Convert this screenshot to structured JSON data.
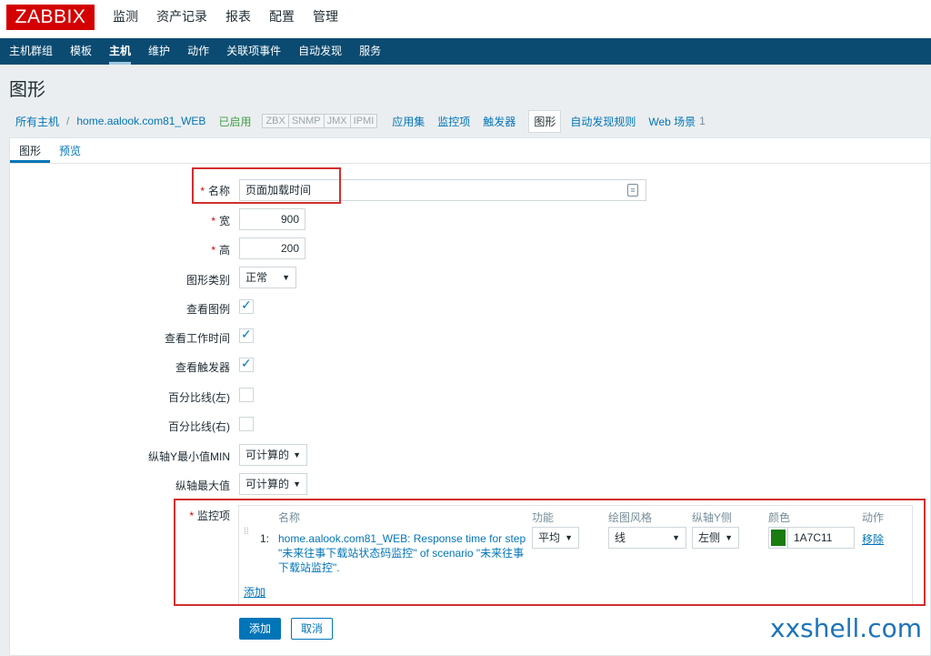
{
  "header": {
    "logo": "ZABBIX",
    "main_nav": [
      "监测",
      "资产记录",
      "报表",
      "配置",
      "管理"
    ],
    "main_nav_active": "配置"
  },
  "subnav": {
    "items": [
      "主机群组",
      "模板",
      "主机",
      "维护",
      "动作",
      "关联项事件",
      "自动发现",
      "服务"
    ],
    "active": "主机"
  },
  "page": {
    "title": "图形"
  },
  "breadcrumb": {
    "all_hosts": "所有主机",
    "separator": "/",
    "host": "home.aalook.com81_WEB",
    "status": "已启用",
    "interfaces": [
      "ZBX",
      "SNMP",
      "JMX",
      "IPMI"
    ],
    "apps": "应用集",
    "items": "监控项",
    "triggers": "触发器",
    "graphs": "图形",
    "discovery": "自动发现规则",
    "web": "Web 场景",
    "web_count": "1"
  },
  "tabs": {
    "graph": "图形",
    "preview": "预览"
  },
  "form": {
    "name_label": "名称",
    "name_value": "页面加载时间",
    "width_label": "宽",
    "width_value": "900",
    "height_label": "高",
    "height_value": "200",
    "type_label": "图形类别",
    "type_value": "正常",
    "legend_label": "查看图例",
    "worktime_label": "查看工作时间",
    "triggers_label": "查看触发器",
    "pct_left_label": "百分比线(左)",
    "pct_right_label": "百分比线(右)",
    "ymin_label": "纵轴Y最小值MIN",
    "ymin_value": "可计算的",
    "ymax_label": "纵轴最大值",
    "ymax_value": "可计算的",
    "items_label": "监控项"
  },
  "items_table": {
    "headers": {
      "name": "名称",
      "func": "功能",
      "style": "绘图风格",
      "yaxis": "纵轴Y侧",
      "color": "颜色",
      "action": "动作"
    },
    "rows": [
      {
        "index": "1:",
        "name_line1": "home.aalook.com81_WEB: Response time for step",
        "name_line2": "\"未来往事下载站状态码监控\" of scenario \"未来往事",
        "name_line3": "下载站监控\".",
        "func": "平均",
        "style": "线",
        "yaxis": "左侧",
        "color_hex": "1A7C11",
        "color_swatch": "#1a7c11",
        "action": "移除"
      }
    ],
    "add": "添加"
  },
  "buttons": {
    "add": "添加",
    "cancel": "取消"
  },
  "watermark": "xxshell.com"
}
